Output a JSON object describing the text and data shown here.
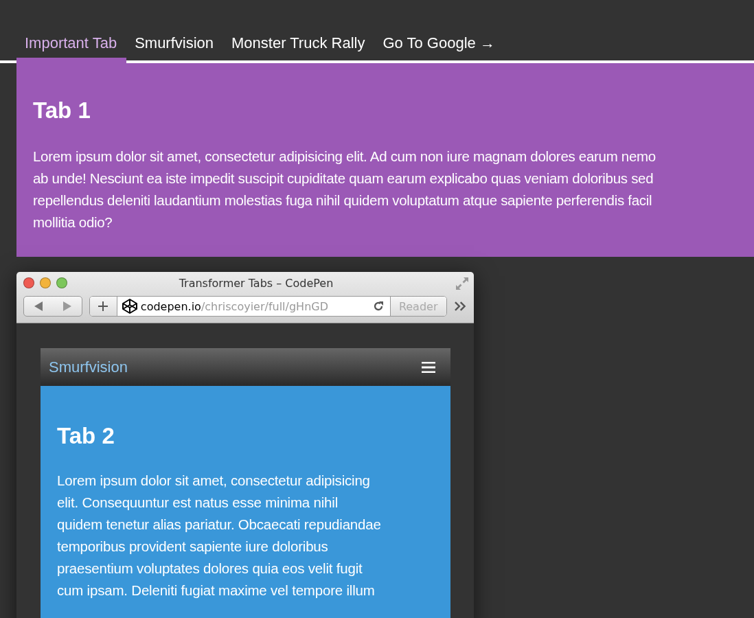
{
  "tabs": [
    {
      "label": "Important Tab",
      "selected": true
    },
    {
      "label": "Smurfvision",
      "selected": false
    },
    {
      "label": "Monster Truck Rally",
      "selected": false
    },
    {
      "label": "Go To Google →",
      "selected": false
    }
  ],
  "panel": {
    "heading": "Tab 1",
    "text": "Lorem ipsum dolor sit amet, consectetur adipisicing elit. Ad cum non iure magnam dolores earum nemo\nab unde! Nesciunt ea iste impedit suscipit cupiditate quam earum explicabo quas veniam doloribus sed\nrepellendus deleniti laudantium molestias fuga nihil quidem voluptatum atque sapiente perferendis facil\nmollitia odio?"
  },
  "browser": {
    "title": "Transformer Tabs – CodePen",
    "url_domain": "codepen.io",
    "url_path": "/chriscoyier/full/gHnGD",
    "reader": "Reader",
    "page": {
      "menu_label": "Smurfvision",
      "heading": "Tab 2",
      "text": "Lorem ipsum dolor sit amet, consectetur adipisicing\nelit. Consequuntur est natus esse minima nihil\nquidem tenetur alias pariatur. Obcaecati repudiandae\ntemporibus provident sapiente iure doloribus\npraesentium voluptates dolores quia eos velit fugit\ncum ipsam. Deleniti fugiat maxime vel tempore illum"
    }
  }
}
